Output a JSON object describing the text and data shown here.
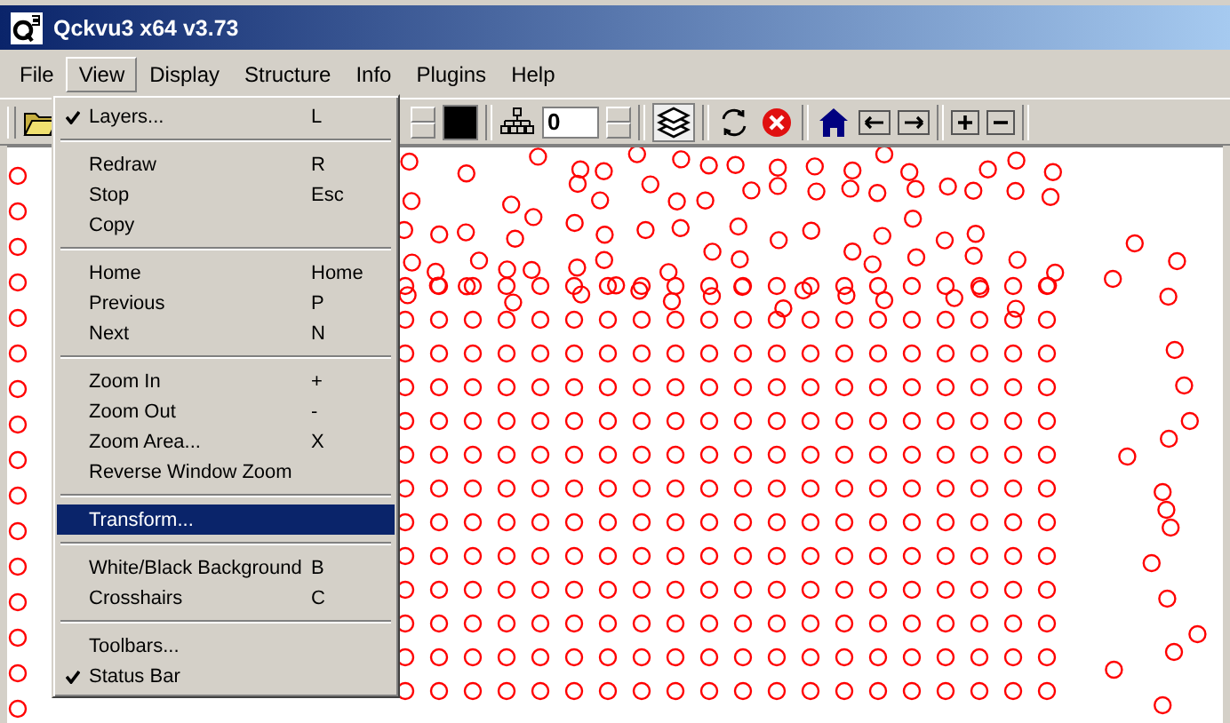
{
  "window": {
    "title": "Qckvu3 x64 v3.73"
  },
  "menubar": [
    {
      "label": "File",
      "selected": false
    },
    {
      "label": "View",
      "selected": true
    },
    {
      "label": "Display",
      "selected": false
    },
    {
      "label": "Structure",
      "selected": false
    },
    {
      "label": "Info",
      "selected": false
    },
    {
      "label": "Plugins",
      "selected": false
    },
    {
      "label": "Help",
      "selected": false
    }
  ],
  "toolbar": {
    "level_field": {
      "value": "0"
    }
  },
  "view_menu": [
    {
      "kind": "item",
      "label": "Layers...",
      "shortcut": "L",
      "checked": true,
      "selected": false
    },
    {
      "kind": "separator"
    },
    {
      "kind": "item",
      "label": "Redraw",
      "shortcut": "R",
      "checked": false,
      "selected": false
    },
    {
      "kind": "item",
      "label": "Stop",
      "shortcut": "Esc",
      "checked": false,
      "selected": false
    },
    {
      "kind": "item",
      "label": "Copy",
      "checked": false,
      "selected": false
    },
    {
      "kind": "separator"
    },
    {
      "kind": "item",
      "label": "Home",
      "shortcut": "Home",
      "checked": false,
      "selected": false
    },
    {
      "kind": "item",
      "label": "Previous",
      "shortcut": "P",
      "checked": false,
      "selected": false
    },
    {
      "kind": "item",
      "label": "Next",
      "shortcut": "N",
      "checked": false,
      "selected": false
    },
    {
      "kind": "separator"
    },
    {
      "kind": "item",
      "label": "Zoom In",
      "shortcut": "+",
      "checked": false,
      "selected": false
    },
    {
      "kind": "item",
      "label": "Zoom Out",
      "shortcut": "-",
      "checked": false,
      "selected": false
    },
    {
      "kind": "item",
      "label": "Zoom Area...",
      "shortcut": "X",
      "checked": false,
      "selected": false
    },
    {
      "kind": "item",
      "label": "Reverse Window Zoom",
      "checked": false,
      "selected": false
    },
    {
      "kind": "separator"
    },
    {
      "kind": "item",
      "label": "Transform...",
      "checked": false,
      "selected": true
    },
    {
      "kind": "separator"
    },
    {
      "kind": "item",
      "label": "White/Black Background",
      "shortcut": "B",
      "checked": false,
      "selected": false
    },
    {
      "kind": "item",
      "label": "Crosshairs",
      "shortcut": "C",
      "checked": false,
      "selected": false
    },
    {
      "kind": "separator"
    },
    {
      "kind": "item",
      "label": "Toolbars...",
      "checked": false,
      "selected": false
    },
    {
      "kind": "item",
      "label": "Status Bar",
      "checked": true,
      "selected": false
    }
  ]
}
